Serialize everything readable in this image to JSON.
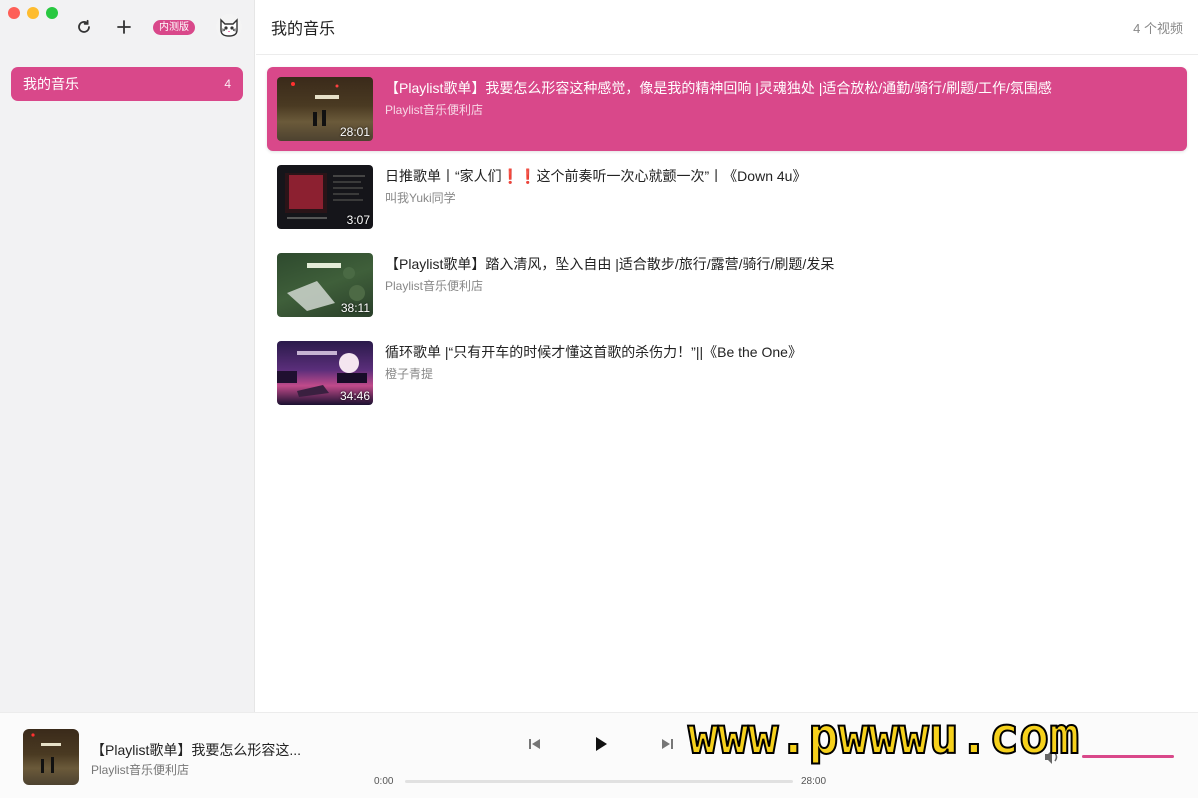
{
  "toolbar": {
    "badge": "内测版"
  },
  "sidebar": {
    "items": [
      {
        "label": "我的音乐",
        "count": "4"
      }
    ]
  },
  "main": {
    "title": "我的音乐",
    "video_count": "4 个视频",
    "videos": [
      {
        "title": "【Playlist歌单】我要怎么形容这种感觉，像是我的精神回响 |灵魂独处 |适合放松/通勤/骑行/刷题/工作/氛围感",
        "uploader": "Playlist音乐便利店",
        "duration": "28:01"
      },
      {
        "title": "日推歌单丨“家人们❗️❗️这个前奏听一次心就颤一次”丨《Down 4u》",
        "uploader": "叫我Yuki同学",
        "duration": "3:07"
      },
      {
        "title": "【Playlist歌单】踏入清风，坠入自由 |适合散步/旅行/露营/骑行/刷题/发呆",
        "uploader": "Playlist音乐便利店",
        "duration": "38:11"
      },
      {
        "title": "循环歌单 |“只有开车的时候才懂这首歌的杀伤力！”||《Be the One》",
        "uploader": "橙子青提",
        "duration": "34:46"
      }
    ]
  },
  "player": {
    "title": "【Playlist歌单】我要怎么形容这...",
    "artist": "Playlist音乐便利店",
    "time_current": "0:00",
    "time_total": "28:00",
    "progress": 0,
    "volume": 1.0
  },
  "watermark": "www.pwwwu.com",
  "colors": {
    "accent": "#d9488a",
    "sidebar_bg": "#f2f2f3"
  }
}
